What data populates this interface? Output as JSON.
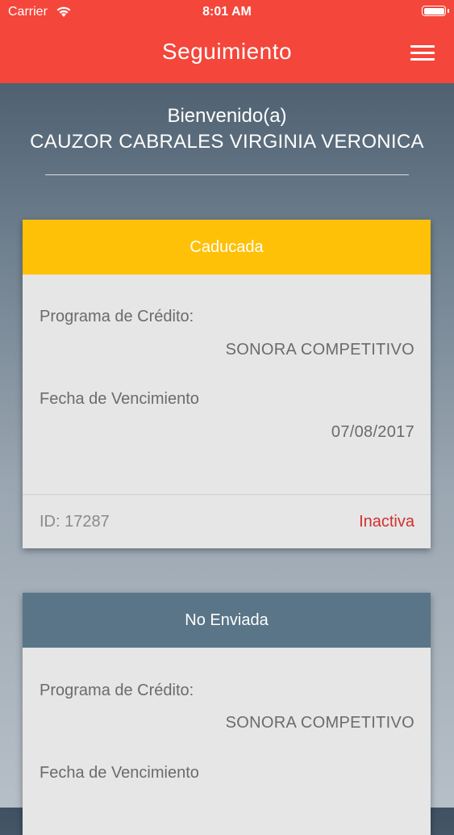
{
  "status_bar": {
    "carrier": "Carrier",
    "time": "8:01 AM"
  },
  "header": {
    "title": "Seguimiento",
    "menu_icon": "hamburger-menu-icon",
    "color": "#f4463b"
  },
  "welcome": {
    "greeting": "Bienvenido(a)",
    "name": "CAUZOR CABRALES VIRGINIA VERONICA"
  },
  "cards": [
    {
      "status_title": "Caducada",
      "header_color": "#ffc107",
      "program_label": "Programa de Crédito:",
      "program_value": "SONORA COMPETITIVO",
      "date_label": "Fecha de Vencimiento",
      "date_value": "07/08/2017",
      "id_text": "ID: 17287",
      "state": "Inactiva",
      "state_color": "#d32f2f"
    },
    {
      "status_title": "No Enviada",
      "header_color": "#5a7587",
      "program_label": "Programa de Crédito:",
      "program_value": "SONORA COMPETITIVO",
      "date_label": "Fecha de Vencimiento"
    }
  ]
}
